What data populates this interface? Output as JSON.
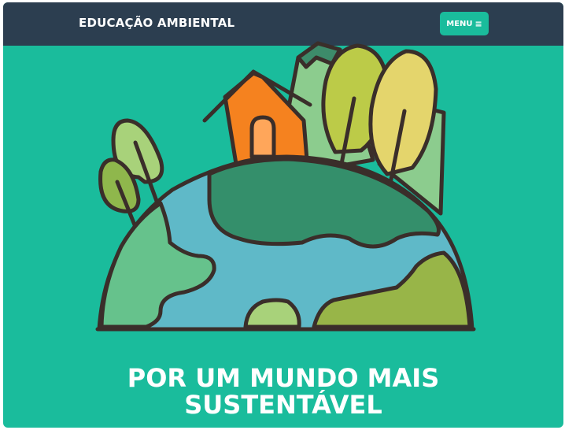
{
  "navbar": {
    "brand": "EDUCAÇÃO AMBIENTAL",
    "menu_label": "MENU",
    "menu_icon": "hamburger-icon",
    "background": "#2c3e50"
  },
  "hero": {
    "illustration": "earth-with-house-and-trees",
    "headline_line1": "POR UM MUNDO MAIS",
    "headline_line2": "SUSTENTÁVEL",
    "background": "#1abc9c"
  }
}
